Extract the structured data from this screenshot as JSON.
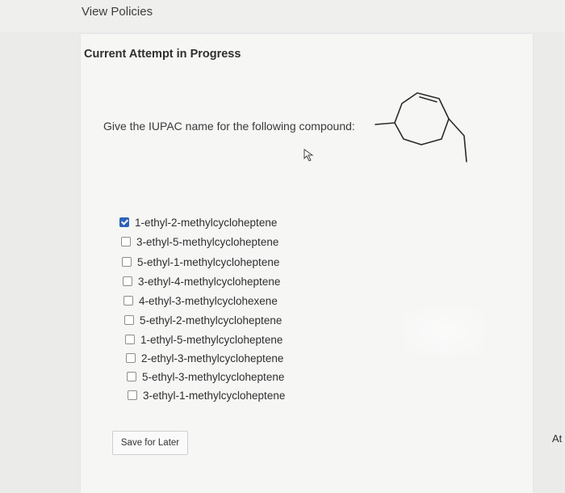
{
  "header": {
    "view_policies": "View Policies"
  },
  "attempt": {
    "heading": "Current Attempt in Progress"
  },
  "question": {
    "prompt": "Give the IUPAC name for the following compound:"
  },
  "choices": [
    {
      "label": "1-ethyl-2-methylcycloheptene",
      "checked": true
    },
    {
      "label": "3-ethyl-5-methylcycloheptene",
      "checked": false
    },
    {
      "label": "5-ethyl-1-methylcycloheptene",
      "checked": false
    },
    {
      "label": "3-ethyl-4-methylcycloheptene",
      "checked": false
    },
    {
      "label": "4-ethyl-3-methylcyclohexene",
      "checked": false
    },
    {
      "label": "5-ethyl-2-methylcycloheptene",
      "checked": false
    },
    {
      "label": "1-ethyl-5-methylcycloheptene",
      "checked": false
    },
    {
      "label": "2-ethyl-3-methylcycloheptene",
      "checked": false
    },
    {
      "label": "5-ethyl-3-methylcycloheptene",
      "checked": false
    },
    {
      "label": "3-ethyl-1-methylcycloheptene",
      "checked": false
    }
  ],
  "actions": {
    "save_label": "Save for Later"
  },
  "side": {
    "cut_text": "At"
  },
  "colors": {
    "accent": "#2b63b8",
    "background": "#ebebea",
    "card": "#f6f6f5"
  }
}
